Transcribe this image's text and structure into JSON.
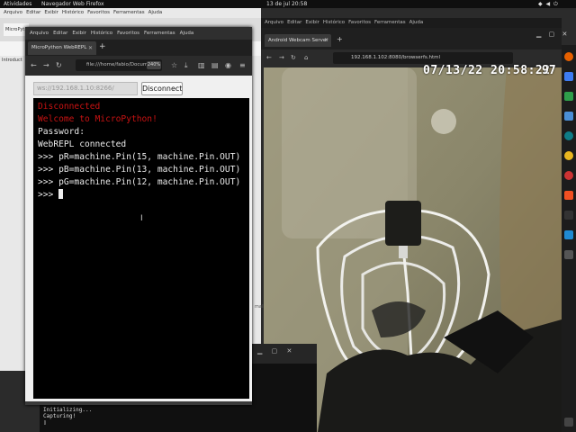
{
  "topbar": {
    "activities": "Atividades",
    "app_name": "Navegador Web Firefox",
    "clock": "13 de jul  20:58"
  },
  "back_window": {
    "menu": [
      "Arquivo",
      "Editar",
      "Exibir",
      "Histórico",
      "Favoritos",
      "Ferramentas",
      "Ajuda"
    ],
    "tab_title": "MicroPyt",
    "link_text": "Introduct",
    "side_text": "mall.pr"
  },
  "mp_window": {
    "menu": [
      "Arquivo",
      "Editar",
      "Exibir",
      "Histórico",
      "Favoritos",
      "Ferramentas",
      "Ajuda"
    ],
    "tab_title": "MicroPython WebREPL",
    "url": "file:///home/fabio/Docum",
    "zoom": "240%",
    "ws_input_value": "ws://192.168.1.10:8266/",
    "disconnect_label": "Disconnect",
    "terminal": {
      "line1": "Disconnected",
      "line2": "Welcome to MicroPython!",
      "line3": "Password:",
      "line4": "WebREPL connected",
      "line5": ">>> pR=machine.Pin(15, machine.Pin.OUT)",
      "line6": ">>> pB=machine.Pin(13, machine.Pin.OUT)",
      "line7": ">>> pG=machine.Pin(12, machine.Pin.OUT)",
      "prompt": ">>> "
    }
  },
  "terminal_window": {
    "line1": "Initializing...",
    "line2": "Capturing!"
  },
  "cam_window": {
    "menu": [
      "Arquivo",
      "Editar",
      "Exibir",
      "Histórico",
      "Favoritos",
      "Ferramentas",
      "Ajuda"
    ],
    "tab_title": "Android Webcam Server",
    "url": "192.168.1.102:8080/browserfs.html",
    "timestamp": "07/13/22 20:58:22",
    "battery": "97"
  },
  "colors": {
    "terminal_red": "#c81212",
    "terminal_text": "#eaeaea"
  }
}
